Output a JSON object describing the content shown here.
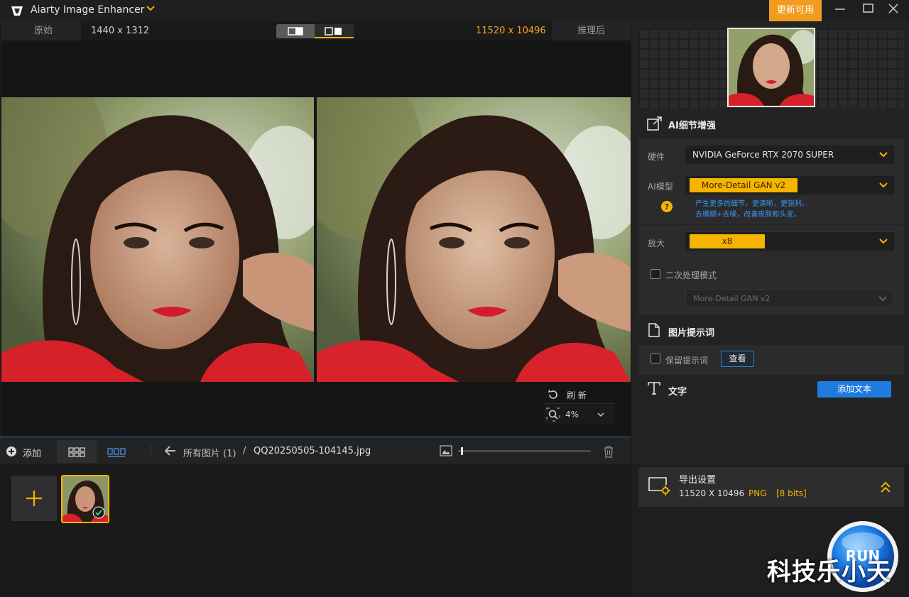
{
  "window": {
    "title": "Aiarty Image Enhancer",
    "update_label": "更新可用"
  },
  "compare": {
    "original_tab": "原始",
    "original_size": "1440 x 1312",
    "result_size": "11520 x 10496",
    "result_tab": "推理后"
  },
  "preview_controls": {
    "refresh_label": "刷  新",
    "zoom_value": "4%"
  },
  "strip": {
    "add_label": "添加",
    "breadcrumb_all": "所有图片 (1)",
    "breadcrumb_sep": "/",
    "breadcrumb_file": "QQ20250505-104145.jpg",
    "size_slider": 0.02
  },
  "panel": {
    "ai_section_title": "AI细节增强",
    "hardware_label": "硬件",
    "hardware_value": "NVIDIA GeForce RTX 2070 SUPER",
    "model_label": "AI模型",
    "model_value": "More-Detail GAN v2",
    "model_desc_line1": "产生更多的细节，更清晰，更锐利。",
    "model_desc_line2": "去模糊+去噪，改善皮肤和头发。",
    "scale_label": "放大",
    "scale_value": "x8",
    "second_pass_label": "二次处理模式",
    "second_pass_model": "More-Detail GAN v2",
    "prompt_section_title": "图片提示词",
    "keep_prompt_label": "保留提示词",
    "view_button": "查看",
    "text_section_title": "文字",
    "add_text_button": "添加文本",
    "export_title": "导出设置",
    "export_size": "11520 X 10496",
    "export_format": "PNG",
    "export_bits": "[8 bits]"
  },
  "watermark": {
    "text": "科技乐小天",
    "badge_text": "RUN"
  },
  "colors": {
    "accent": "#f4b400",
    "update": "#f29c1f",
    "blue": "#1e7be0",
    "orange_text": "#f4a51f"
  }
}
